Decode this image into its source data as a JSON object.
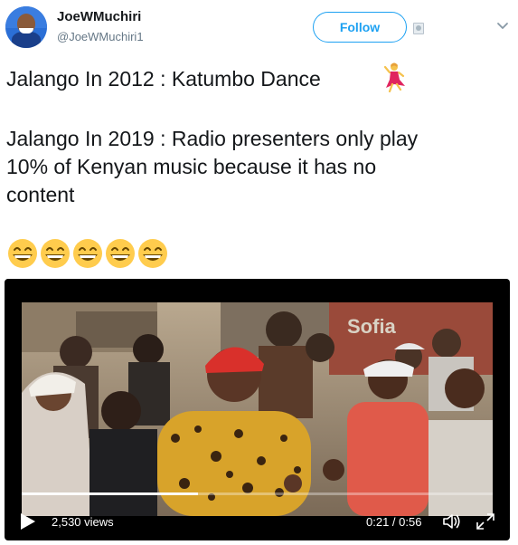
{
  "tweet": {
    "display_name": "JoeWMuchiri",
    "handle": "@JoeWMuchiri1",
    "follow_label": "Follow",
    "text_line1": "Jalango In 2012 : Katumbo Dance",
    "text_line2": "Jalango In 2019 : Radio presenters only play",
    "text_line3": "10% of Kenyan music because it has no",
    "text_line4": "content",
    "emoji_count": 5,
    "icons": {
      "dancer": "woman-dancing-emoji",
      "grin": "grinning-face-with-smiling-eyes-emoji",
      "menu": "chevron-down-icon"
    }
  },
  "video": {
    "views_label": "2,530 views",
    "time_label": "0:21 / 0:56",
    "progress_fraction": 0.375,
    "sign_text": "Sofia",
    "icons": {
      "play": "play-icon",
      "volume": "volume-icon",
      "expand": "expand-icon"
    }
  },
  "colors": {
    "accent": "#1da1f2",
    "text": "#14171a",
    "secondary": "#657786"
  }
}
